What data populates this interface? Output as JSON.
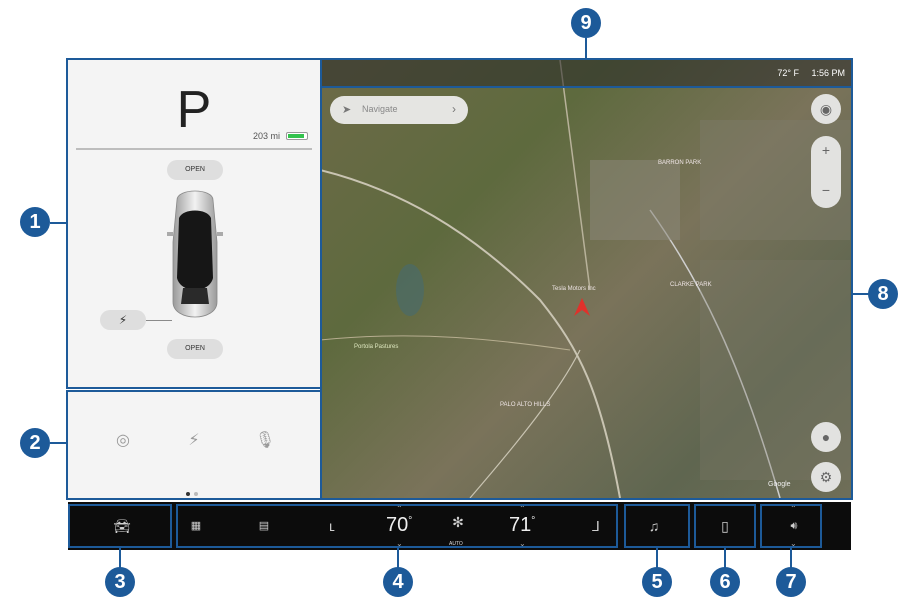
{
  "car_panel": {
    "gear": "P",
    "range": "203 mi",
    "battery_color": "#33c24d",
    "frunk_label": "OPEN",
    "trunk_label": "OPEN",
    "charge_icon": "lightning-bolt-icon"
  },
  "quick_controls": {
    "icons": [
      "dashcam-icon",
      "lightning-bolt-icon",
      "microphone-icon"
    ],
    "page_dots": 2,
    "active_dot": 1
  },
  "map": {
    "navigate_placeholder": "Navigate",
    "outside_temp": "72° F",
    "time": "1:56 PM",
    "labels": {
      "tesla_motors": "Tesla Motors Inc",
      "palo_alto_hills": "PALO ALTO HILLS",
      "barron_park": "BARRON PARK",
      "clarke_park": "CLARKE PARK",
      "portola_pastures": "Portola Pastures",
      "google": "Google"
    }
  },
  "dock": {
    "driver_temp": "70",
    "passenger_temp": "71",
    "fan_mode": "AUTO",
    "degree_sign": "°"
  },
  "callouts": [
    "1",
    "2",
    "3",
    "4",
    "5",
    "6",
    "7",
    "8",
    "9"
  ],
  "colors": {
    "callout_blue": "#1d5a99",
    "dock_bg": "#0c0c0c",
    "panel_bg": "#f4f4f4",
    "nav_pin_red": "#e0312b"
  }
}
